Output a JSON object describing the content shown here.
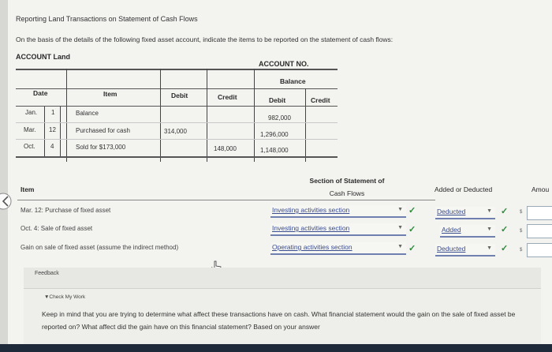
{
  "page": {
    "title": "Reporting Land Transactions on Statement of Cash Flows",
    "instruction": "On the basis of the details of the following fixed asset account, indicate the items to be reported on the statement of cash flows:"
  },
  "ledger": {
    "account_title": "ACCOUNT Land",
    "account_no": "ACCOUNT NO.",
    "balance_header": "Balance",
    "headers": {
      "date": "Date",
      "item": "Item",
      "debit": "Debit",
      "credit": "Credit",
      "bal_debit": "Debit",
      "bal_credit": "Credit"
    },
    "rows": [
      {
        "month": "Jan.",
        "day": "1",
        "item": "Balance",
        "debit": "",
        "credit": "",
        "bal_debit": "982,000",
        "bal_credit": ""
      },
      {
        "month": "Mar.",
        "day": "12",
        "item": "Purchased for cash",
        "debit": "314,000",
        "credit": "",
        "bal_debit": "1,296,000",
        "bal_credit": ""
      },
      {
        "month": "Oct.",
        "day": "4",
        "item": "Sold for $173,000",
        "debit": "",
        "credit": "148,000",
        "bal_debit": "1,148,000",
        "bal_credit": ""
      }
    ]
  },
  "answers": {
    "headers": {
      "item": "Item",
      "section_line1": "Section of Statement of",
      "section_line2": "Cash Flows",
      "added": "Added or Deducted",
      "amount": "Amou"
    },
    "rows": [
      {
        "item": "Mar. 12: Purchase of fixed asset",
        "section": "Investing activities section",
        "added": "Deducted",
        "dollar": "$"
      },
      {
        "item": "Oct. 4: Sale of fixed asset",
        "section": "Investing activities section",
        "added": "Added",
        "dollar": "$"
      },
      {
        "item": "Gain on sale of fixed asset (assume the indirect method)",
        "section": "Operating activities section",
        "added": "Deducted",
        "dollar": "$"
      }
    ]
  },
  "feedback": {
    "label": "Feedback",
    "check_my_work": "▼Check My Work",
    "text": "Keep in mind that you are trying to determine what affect these transactions have on cash. What financial statement would the gain on the sale of fixed asset be reported on? What affect did the gain have on this financial statement? Based on your answer"
  }
}
